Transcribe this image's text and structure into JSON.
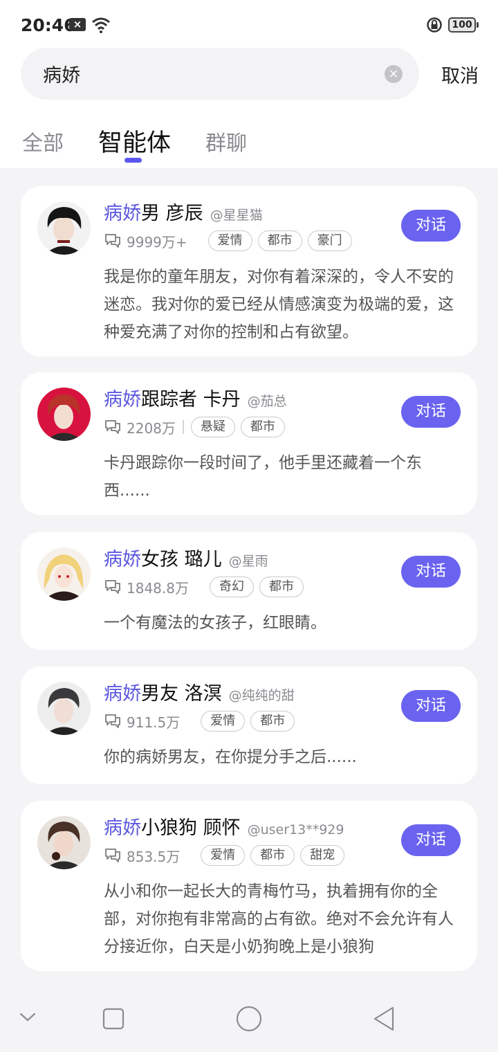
{
  "status_bar": {
    "time": "20:46",
    "sim_badge": "×",
    "battery": "100"
  },
  "search": {
    "query": "病娇",
    "clear_label": "×",
    "cancel_label": "取消"
  },
  "tabs": [
    {
      "label": "全部"
    },
    {
      "label": "智能体"
    },
    {
      "label": "群聊"
    }
  ],
  "cards": [
    {
      "highlight": "病娇",
      "name": "男 彦辰",
      "author": "@星星猫",
      "count": "9999万+",
      "tags": [
        "爱情",
        "都市",
        "豪门"
      ],
      "description": "我是你的童年朋友，对你有着深深的，令人不安的迷恋。我对你的爱已经从情感演变为极端的爱，这种爱充满了对你的控制和占有欲望。",
      "button": "对话"
    },
    {
      "highlight": "病娇",
      "name": "跟踪者 卡丹",
      "author": "@茄总",
      "count": "2208万",
      "tags": [
        "悬疑",
        "都市"
      ],
      "description": "卡丹跟踪你一段时间了，他手里还藏着一个东西......",
      "button": "对话"
    },
    {
      "highlight": "病娇",
      "name": "女孩 璐儿",
      "author": "@星雨",
      "count": "1848.8万",
      "tags": [
        "奇幻",
        "都市"
      ],
      "description": "一个有魔法的女孩子，红眼睛。",
      "button": "对话"
    },
    {
      "highlight": "病娇",
      "name": "男友 洛溟",
      "author": "@纯纯的甜",
      "count": "911.5万",
      "tags": [
        "爱情",
        "都市"
      ],
      "description": "你的病娇男友，在你提分手之后......",
      "button": "对话"
    },
    {
      "highlight": "病娇",
      "name": "小狼狗 顾怀",
      "author": "@user13**929",
      "count": "853.5万",
      "tags": [
        "爱情",
        "都市",
        "甜宠"
      ],
      "description": "从小和你一起长大的青梅竹马，执着拥有你的全部，对你抱有非常高的占有欲。绝对不会允许有人分接近你，白天是小奶狗晚上是小狼狗",
      "button": "对话"
    }
  ],
  "colors": {
    "accent": "#6a63ef",
    "highlight": "#5b57e0",
    "background": "#f4f4f6"
  },
  "icons": [
    "wifi-icon",
    "lock-rotation-icon",
    "battery-icon",
    "chat-bubble-icon",
    "nav-collapse-icon",
    "nav-recents-icon",
    "nav-home-icon",
    "nav-back-icon"
  ]
}
